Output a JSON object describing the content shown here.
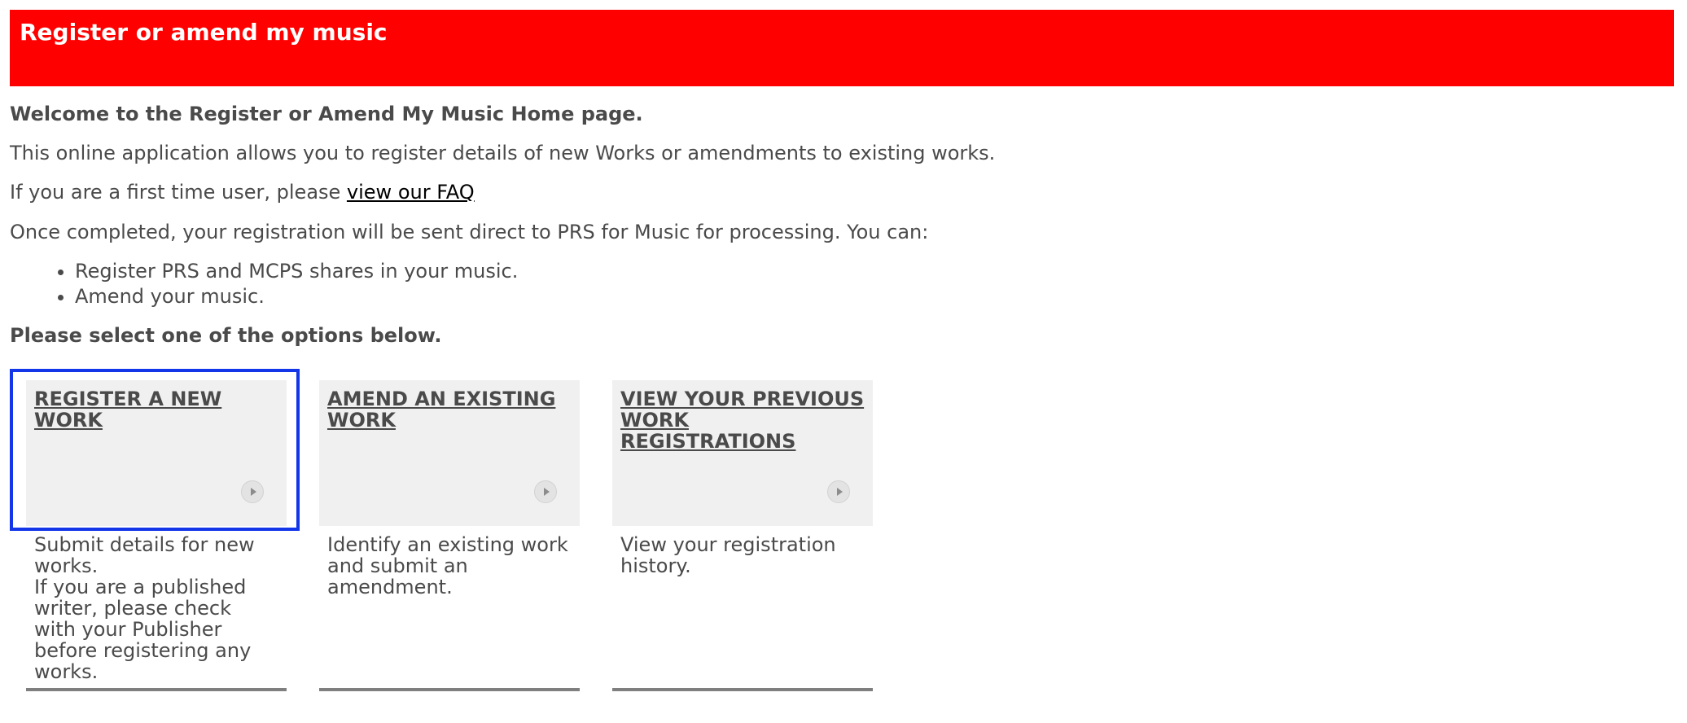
{
  "header": {
    "title": "Register or amend my music",
    "color": "#ff0000"
  },
  "intro": {
    "welcome": "Welcome to the Register or Amend My Music Home page.",
    "description": "This online application allows you to register details of new Works or amendments to existing works.",
    "first_time_prefix": "If you are a first time user, please ",
    "faq_link": "view our FAQ",
    "completion": "Once completed, your registration will be sent direct to PRS for Music for processing. You can:",
    "features": [
      "Register PRS and MCPS shares in your music.",
      "Amend your music."
    ],
    "select_prompt": "Please select one of the options below."
  },
  "options": [
    {
      "title": "REGISTER A NEW WORK",
      "icon": "play-arrow-icon",
      "description": "Submit details for new works.",
      "note": "If you are a published writer, please check with your Publisher before registering any works.",
      "focused": true
    },
    {
      "title": "AMEND AN EXISTING WORK",
      "icon": "play-arrow-icon",
      "description": "Identify an existing work and submit an amendment."
    },
    {
      "title": "VIEW YOUR PREVIOUS WORK REGISTRATIONS",
      "icon": "play-arrow-icon",
      "description": "View your registration history."
    }
  ],
  "colors": {
    "focus": "#1236e8",
    "card_bg": "#f0f0f0",
    "text": "#4a4a4a"
  }
}
